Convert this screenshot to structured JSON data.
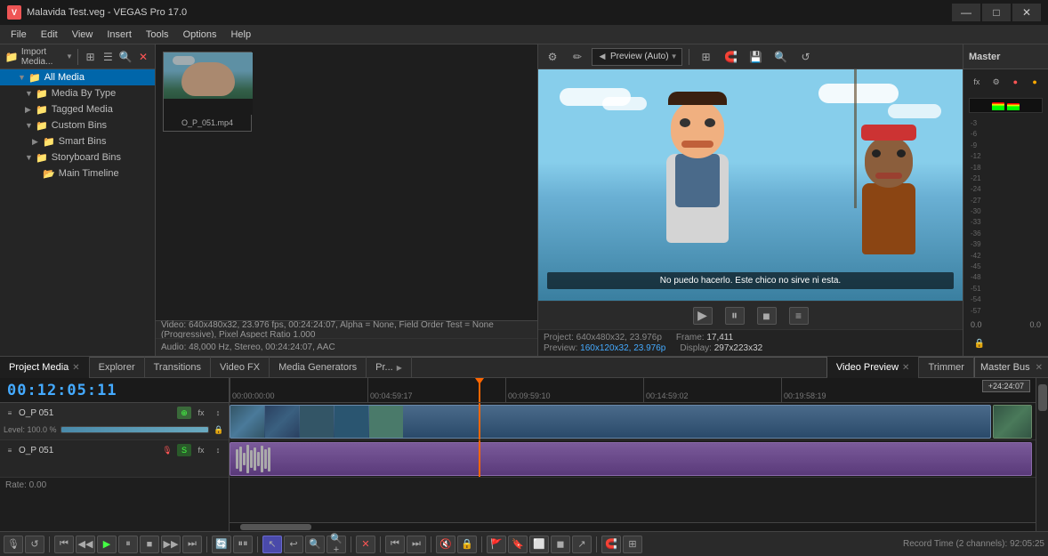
{
  "app": {
    "title": "Malavida Test.veg - VEGAS Pro 17.0",
    "icon": "V"
  },
  "titlebar": {
    "minimize": "—",
    "maximize": "□",
    "close": "✕"
  },
  "menu": {
    "items": [
      "File",
      "Edit",
      "View",
      "Insert",
      "Tools",
      "Options",
      "Help"
    ]
  },
  "sidebar": {
    "tree": [
      {
        "label": "All Media",
        "level": 0,
        "selected": true,
        "icon": "folder",
        "expanded": true
      },
      {
        "label": "Media By Type",
        "level": 1,
        "icon": "folder",
        "expanded": true
      },
      {
        "label": "Tagged Media",
        "level": 1,
        "icon": "folder"
      },
      {
        "label": "Custom Bins",
        "level": 1,
        "icon": "folder",
        "expanded": true
      },
      {
        "label": "Smart Bins",
        "level": 2,
        "icon": "folder"
      },
      {
        "label": "Storyboard Bins",
        "level": 1,
        "icon": "folder",
        "expanded": true
      },
      {
        "label": "Main Timeline",
        "level": 2,
        "icon": "folder-open"
      }
    ]
  },
  "media": {
    "filename": "O_P_051.mp4",
    "info": "Video: 640x480x32, 23.976 fps, 00:24:24:07, Alpha = None, Field Order Test = None (Progressive), Pixel Aspect Ratio 1.000",
    "info2": "Audio: 48,000 Hz, Stereo, 00:24:24:07, AAC"
  },
  "preview": {
    "title": "Preview (Auto)",
    "project_info": "Project: 640x480x32, 23.976p",
    "frame_label": "Frame:",
    "frame_value": "17,411",
    "display_label": "Display:",
    "display_value": "297x223x32",
    "preview_label": "Preview:",
    "preview_value": "160x120x32, 23.976p",
    "subtitle": "No puedo hacerlo. Este chico no sirve ni esta."
  },
  "mixer": {
    "label": "Master",
    "vu_levels": [
      85,
      72
    ],
    "scale": [
      "-3",
      "-6",
      "-9",
      "-12",
      "-18",
      "-21",
      "-24",
      "-27",
      "-30",
      "-33",
      "-36",
      "-39",
      "-42",
      "-45",
      "-48",
      "-51",
      "-54",
      "-57"
    ]
  },
  "timeline": {
    "timecode": "00:12:05:11",
    "rate": "Rate: 0.00",
    "markers": [
      "00:00:00:00",
      "00:04:59:17",
      "00:09:59:10",
      "00:14:59:02",
      "00:19:58:19"
    ],
    "end_marker": "+24:24:07",
    "tracks": [
      {
        "name": "O_P 051",
        "type": "video",
        "level": "Level: 100.0 %",
        "clip_start": 0,
        "clip_end": 100
      },
      {
        "name": "O_P 051",
        "type": "audio",
        "level": "",
        "clip_start": 0,
        "clip_end": 100
      }
    ]
  },
  "bottom_tabs": [
    {
      "label": "Project Media",
      "active": true,
      "closeable": true
    },
    {
      "label": "Explorer"
    },
    {
      "label": "Transitions"
    },
    {
      "label": "Video FX"
    },
    {
      "label": "Media Generators"
    },
    {
      "label": "Pr...",
      "more": true
    }
  ],
  "bottom_tabs2": [
    {
      "label": "Video Preview",
      "active": true,
      "closeable": true
    },
    {
      "label": "Trimmer"
    }
  ],
  "master_bus": {
    "label": "Master Bus",
    "closeable": true
  },
  "transport": {
    "buttons": [
      "🎙",
      "↺",
      "⏮",
      "◀",
      "▶",
      "⏸",
      "⏹",
      "⏭",
      "⏭",
      "⏭",
      "⏸⏸"
    ]
  },
  "status": {
    "record_time": "Record Time (2 channels): 92:05:25"
  }
}
